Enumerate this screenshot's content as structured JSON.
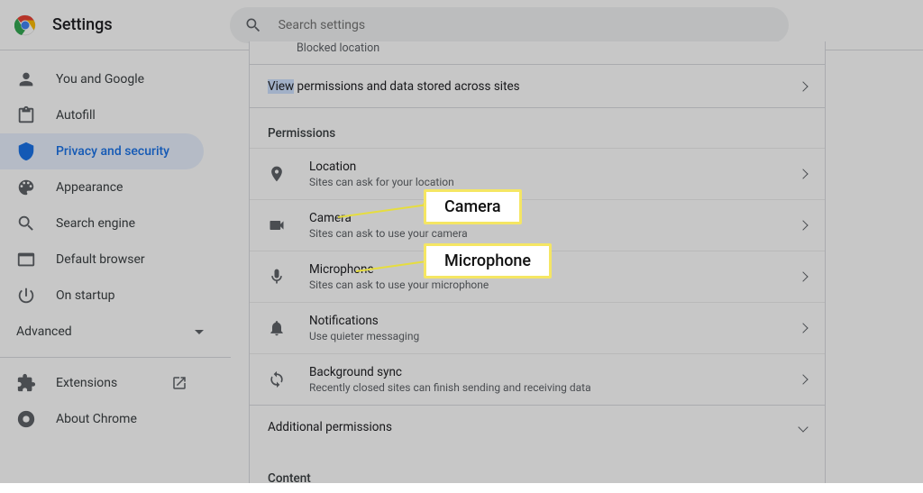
{
  "app_title": "Settings",
  "search_placeholder": "Search settings",
  "sidebar": {
    "items": [
      {
        "label": "You and Google"
      },
      {
        "label": "Autofill"
      },
      {
        "label": "Privacy and security"
      },
      {
        "label": "Appearance"
      },
      {
        "label": "Search engine"
      },
      {
        "label": "Default browser"
      },
      {
        "label": "On startup"
      }
    ],
    "advanced_label": "Advanced",
    "extensions_label": "Extensions",
    "about_label": "About Chrome"
  },
  "main": {
    "blocked_location": "Blocked location",
    "view_link_word": "View",
    "view_link_rest": " permissions and data stored across sites",
    "permissions_header": "Permissions",
    "permissions": [
      {
        "title": "Location",
        "sub": "Sites can ask for your location"
      },
      {
        "title": "Camera",
        "sub": "Sites can ask to use your camera"
      },
      {
        "title": "Microphone",
        "sub": "Sites can ask to use your microphone"
      },
      {
        "title": "Notifications",
        "sub": "Use quieter messaging"
      },
      {
        "title": "Background sync",
        "sub": "Recently closed sites can finish sending and receiving data"
      }
    ],
    "additional_permissions": "Additional permissions",
    "content_header": "Content"
  },
  "annotations": {
    "camera": "Camera",
    "microphone": "Microphone"
  }
}
